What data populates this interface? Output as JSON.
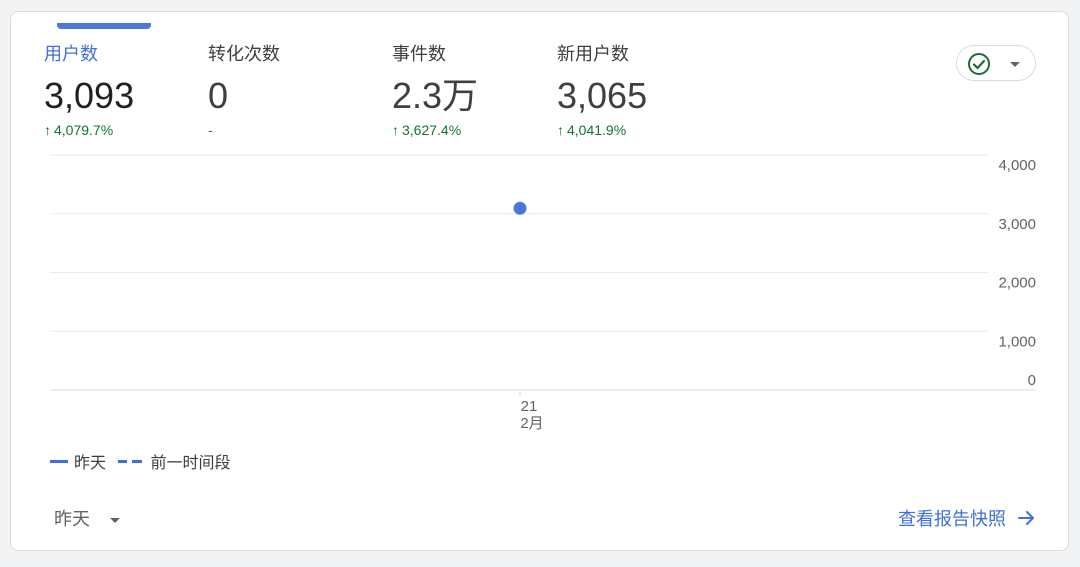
{
  "metrics": [
    {
      "label": "用户数",
      "value": "3,093",
      "change": "4,079.7%",
      "trend": "up",
      "active": true
    },
    {
      "label": "转化次数",
      "value": "0",
      "change": "-",
      "trend": "none",
      "active": false
    },
    {
      "label": "事件数",
      "value": "2.3万",
      "change": "3,627.4%",
      "trend": "up",
      "active": false
    },
    {
      "label": "新用户数",
      "value": "3,065",
      "change": "4,041.9%",
      "trend": "up",
      "active": false
    }
  ],
  "trend_arrow": "↑",
  "status_icon": "check-circle-icon",
  "chart_data": {
    "type": "scatter",
    "x": [
      "21 2月"
    ],
    "x_tick_day": "21",
    "x_tick_month": "2月",
    "series": [
      {
        "name": "昨天",
        "values": [
          3093
        ],
        "style": "solid",
        "color": "#4a78d8"
      }
    ],
    "y_ticks": [
      "4,000",
      "3,000",
      "2,000",
      "1,000",
      "0"
    ],
    "ylim": [
      0,
      4000
    ],
    "grid": true,
    "legend_position": "bottom-left"
  },
  "legend": {
    "current": "昨天",
    "previous": "前一时间段"
  },
  "date_range": {
    "label": "昨天"
  },
  "snapshot_link": {
    "label": "查看报告快照"
  },
  "colors": {
    "accent": "#3f6fd8",
    "positive": "#137333",
    "status_check": "#1e6c35"
  }
}
